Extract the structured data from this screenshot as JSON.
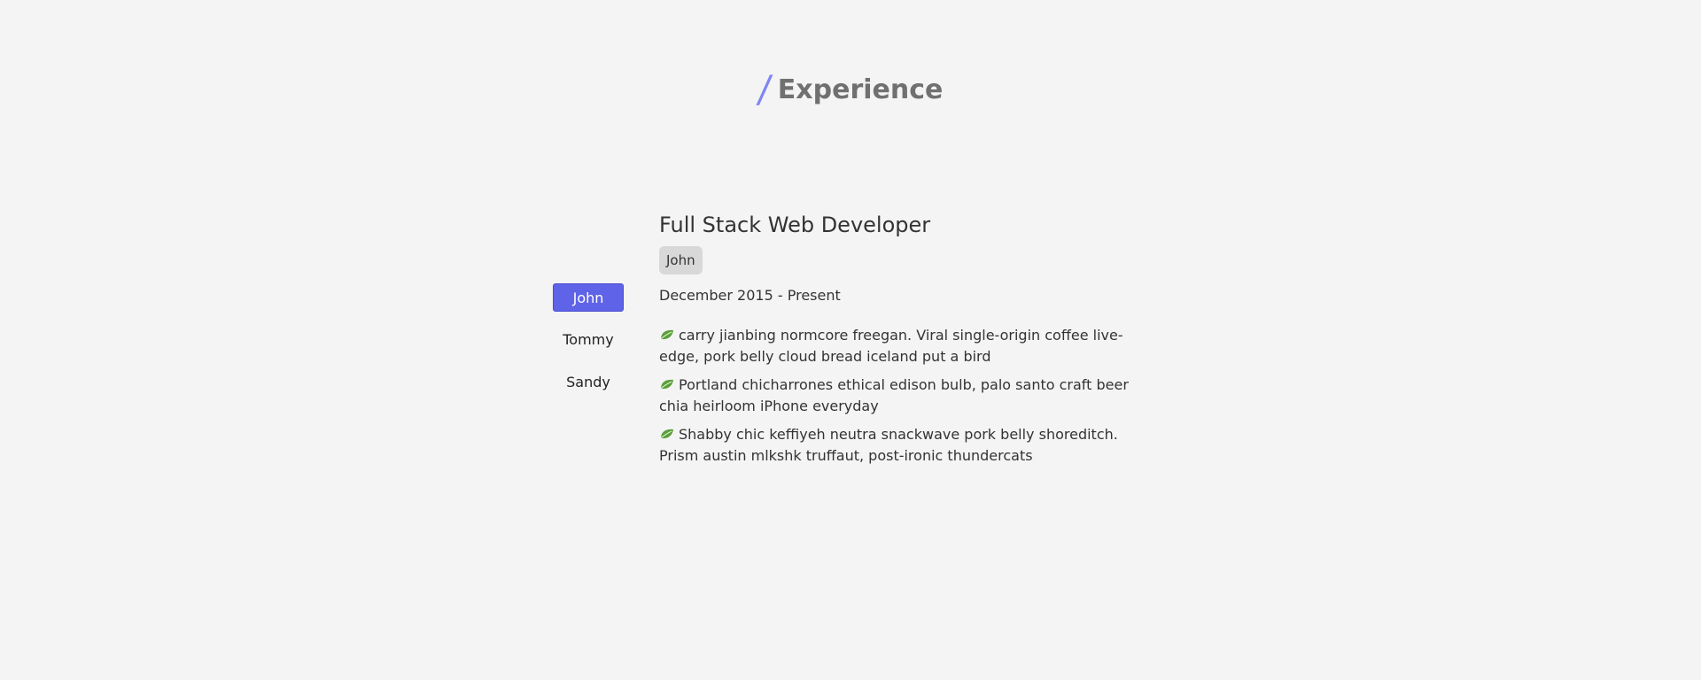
{
  "section": {
    "slash": "/",
    "title": "Experience"
  },
  "tabs": [
    {
      "label": "John",
      "active": true
    },
    {
      "label": "Tommy",
      "active": false
    },
    {
      "label": "Sandy",
      "active": false
    }
  ],
  "detail": {
    "job_title": "Full Stack Web Developer",
    "company": "John",
    "dates": "December 2015 - Present",
    "bullets": [
      "carry jianbing normcore freegan. Viral single-origin coffee live-edge, pork belly cloud bread iceland put a bird",
      "Portland chicharrones ethical edison bulb, palo santo craft beer chia heirloom iPhone everyday",
      "Shabby chic keffiyeh neutra snackwave pork belly shoreditch. Prism austin mlkshk truffaut, post-ironic thundercats"
    ],
    "bullet_icon": "leaf-icon"
  },
  "colors": {
    "accent": "#5f63e8",
    "slash": "#7f86f3",
    "background": "#f4f4f4",
    "badge": "#d8d8d8"
  }
}
